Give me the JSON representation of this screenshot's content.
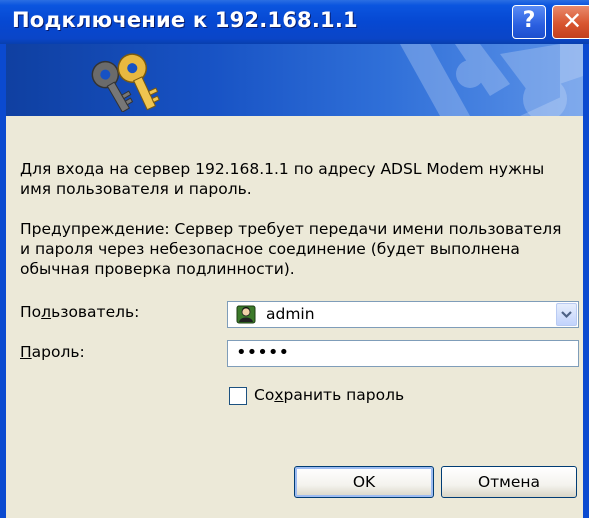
{
  "window": {
    "title": "Подключение к 192.168.1.1",
    "help_symbol": "?",
    "close_symbol": "✕"
  },
  "banner": {
    "icon": "keys-icon"
  },
  "message": {
    "intro": "Для входа на сервер 192.168.1.1 по адресу ADSL Modem нужны имя пользователя и пароль.",
    "warning": "Предупреждение: Сервер требует передачи имени пользователя и пароля через небезопасное соединение (будет выполнена обычная проверка подлинности)."
  },
  "form": {
    "user_label_pre": "По",
    "user_label_ul": "л",
    "user_label_post": "ьзователь:",
    "user_value": "admin",
    "password_label_ul": "П",
    "password_label_post": "ароль:",
    "password_value": "•••••",
    "remember_pre": "Со",
    "remember_ul": "х",
    "remember_post": "ранить пароль",
    "remember_checked": false
  },
  "buttons": {
    "ok": "OK",
    "cancel": "Отмена"
  },
  "colors": {
    "titlebar": "#0648d2",
    "dialog_bg": "#ece9d8",
    "close_button": "#d8552f"
  }
}
